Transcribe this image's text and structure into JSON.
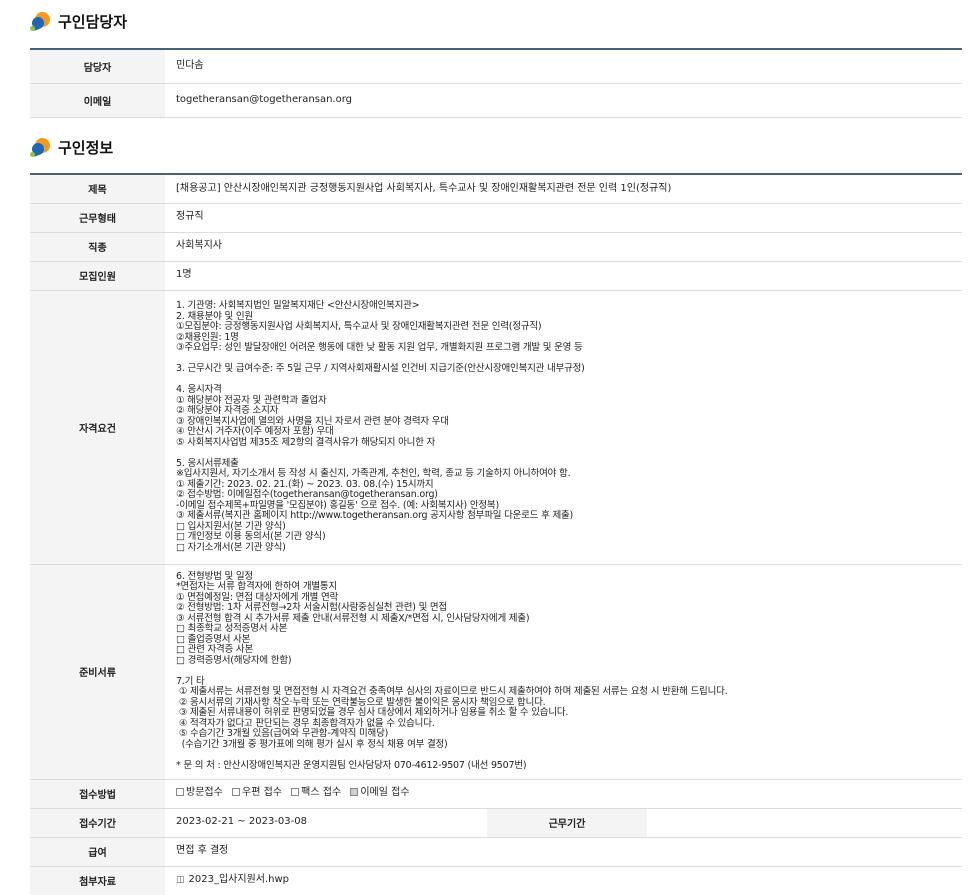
{
  "contact_section": {
    "title": "구인담당자",
    "rows": [
      {
        "label": "담당자",
        "value": "민다솜"
      },
      {
        "label": "이메일",
        "value": "togetheransan@togetheransan.org"
      }
    ]
  },
  "job_section": {
    "title": "구인정보",
    "title_row": {
      "label": "제목",
      "value": "[채용공고] 안산시장애인복지관 긍정행동지원사업 사회복지사, 특수교사 및 장애인재활복지관련 전문 인력 1인(정규직)"
    },
    "employment_type": {
      "label": "근무형태",
      "value": "정규직"
    },
    "job_type": {
      "label": "직종",
      "value": "사회복지사"
    },
    "headcount": {
      "label": "모집인원",
      "value": "1명"
    },
    "qualifications": {
      "label": "자격요건",
      "text": "1. 기관명: 사회복지법인 밀알복지재단 <안산시장애인복지관>\n2. 채용분야 및 인원\n①모집분야: 긍정행동지원사업 사회복지사, 특수교사 및 장애인재활복지관련 전문 인력(정규직)\n②채용인원: 1명\n③주요업무: 성인 발달장애인 어려운 행동에 대한 낮 활동 지원 업무, 개별화지원 프로그램 개발 및 운영 등\n\n3. 근무시간 및 급여수준: 주 5일 근무 / 지역사회재활시설 인건비 지급기준(안산시장애인복지관 내부규정)\n\n4. 응시자격\n① 해당분야 전공자 및 관련학과 졸업자\n② 해당분야 자격증 소지자\n③ 장애인복지사업에 열의와 사명을 지닌 자로서 관련 분야 경력자 우대\n④ 안산시 거주자(이주 예정자 포함) 우대\n⑤ 사회복지사업법 제35조 제2항의 결격사유가 해당되지 아니한 자\n\n5. 응시서류제출\n※입사지원서, 자기소개서 등 작성 시 출신지, 가족관계, 추천인, 학력, 종교 등 기술하지 아니하여야 함.\n① 제출기간: 2023. 02. 21.(화) ~ 2023. 03. 08.(수) 15시까지\n② 접수방법: 이메일접수(togetheransan@togetheransan.org)\n-이메일 접수제목+파일명을 '모집분야) 홍길동' 으로 접수. (예: 사회복지사) 안정복)\n③ 제출서류(복지관 홈페이지 http://www.togetheransan.org 공지사항 첨부파일 다운로드 후 제출)\n□ 입사지원서(본 기관 양식)\n□ 개인정보 이용 동의서(본 기관 양식)\n□ 자기소개서(본 기관 양식)"
    },
    "documents": {
      "label": "준비서류",
      "text": "6. 전형방법 및 일정\n*면접자는 서류 합격자에 한하여 개별통지\n① 면접예정일: 면접 대상자에게 개별 연락\n② 전형방법: 1차 서류전형→2차 서술시험(사람중심실천 관련) 및 면접\n③ 서류전형 합격 시 추가서류 제출 안내(서류전형 시 제출X/*면접 시, 인사담당자에게 제출)\n□ 최종학교 성적증명서 사본\n□ 졸업증명서 사본\n□ 관련 자격증 사본\n□ 경력증명서(해당자에 한함)\n\n7.기 타\n ① 제출서류는 서류전형 및 면접전형 시 자격요건 충족여부 심사의 자료이므로 반드시 제출하여야 하며 제출된 서류는 요청 시 반환해 드립니다.\n ② 응시서류의 기재사항 착오·누락 또는 연락불능으로 발생한 불이익은 응시자 책임으로 합니다.\n ③ 제출된 서류내용이 허위로 판명되었을 경우 심사 대상에서 제외하거나 임용을 취소 할 수 있습니다.\n ④ 적격자가 없다고 판단되는 경우 최종합격자가 없을 수 있습니다.\n ⑤ 수습기간 3개월 있음(급여와 무관함-계약직 미해당)\n  (수습기간 3개월 중 평가표에 의해 평가 실시 후 정식 채용 여부 결정)\n\n* 문 의 처 : 안산시장애인복지관 운영지원팀 인사담당자 070-4612-9507 (내선 9507번)"
    },
    "application_method": {
      "label": "접수방법",
      "options": [
        {
          "label": "방문접수",
          "checked": false
        },
        {
          "label": "우편 접수",
          "checked": false
        },
        {
          "label": "팩스 접수",
          "checked": false
        },
        {
          "label": "이메일 접수",
          "checked": true
        }
      ]
    },
    "period": {
      "label": "접수기간",
      "value": "2023-02-21 ~ 2023-03-08",
      "work_label": "근무기간",
      "work_value": ""
    },
    "salary": {
      "label": "급여",
      "value": "면접 후 결정"
    },
    "attachment": {
      "label": "첨부자료",
      "file": "2023_입사지원서.hwp",
      "file_icon": "file-icon"
    }
  }
}
